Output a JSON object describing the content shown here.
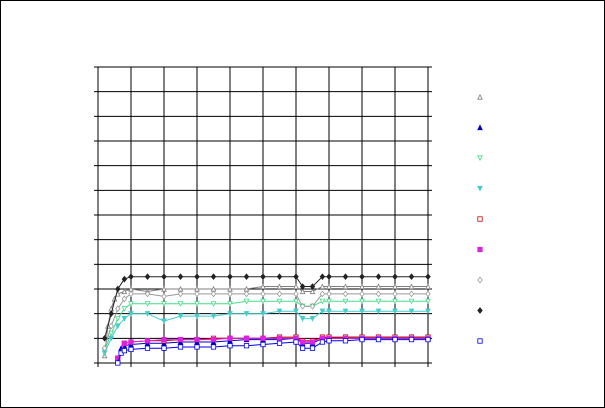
{
  "chart_data": {
    "type": "line",
    "title": "",
    "xlabel": "",
    "ylabel": "",
    "xlim": [
      0,
      10
    ],
    "ylim": [
      0,
      12
    ],
    "x_gridlines": 10,
    "y_gridlines": 12,
    "grid": true,
    "legend_placement": "right",
    "series": [
      {
        "marker": "triangle-up-open",
        "color": "#7f7f7f",
        "x": [
          0.2,
          0.3,
          0.4,
          0.5,
          0.6,
          0.8,
          1,
          1.5,
          2,
          2.5,
          3,
          3.5,
          4,
          4.5,
          5,
          5.5,
          6,
          6.2,
          6.5,
          6.8,
          7,
          7.5,
          8,
          8.5,
          9,
          9.5,
          10
        ],
        "y": [
          0.3,
          1.5,
          2.2,
          2.6,
          2.8,
          2.9,
          3.0,
          2.9,
          3.0,
          3.0,
          3.0,
          3.0,
          3.0,
          3.0,
          3.1,
          3.1,
          3.1,
          2.9,
          2.9,
          3.1,
          3.1,
          3.1,
          3.1,
          3.1,
          3.1,
          3.1,
          3.1
        ]
      },
      {
        "marker": "triangle-up",
        "color": "#0000cc",
        "x": [
          0.6,
          0.7,
          0.8,
          1,
          1.5,
          2,
          2.5,
          3,
          3.5,
          4,
          4.5,
          5,
          5.5,
          6,
          6.2,
          6.5,
          6.8,
          7,
          7.5,
          8,
          8.5,
          9,
          9.5,
          10
        ],
        "y": [
          0.1,
          0.6,
          0.7,
          0.75,
          0.8,
          0.8,
          0.85,
          0.85,
          0.85,
          0.9,
          0.95,
          0.95,
          0.95,
          1.0,
          0.8,
          0.8,
          1.0,
          1.0,
          1.05,
          1.05,
          1.05,
          1.05,
          1.05,
          1.05
        ]
      },
      {
        "marker": "triangle-down-open",
        "color": "#44dd88",
        "x": [
          0.2,
          0.4,
          0.6,
          0.8,
          1,
          1.5,
          2,
          2.5,
          3,
          3.5,
          4,
          4.5,
          5,
          5.5,
          6,
          6.2,
          6.5,
          6.8,
          7,
          7.5,
          8,
          8.5,
          9,
          9.5,
          10
        ],
        "y": [
          0.5,
          1.2,
          1.8,
          2.2,
          2.4,
          2.4,
          2.4,
          2.4,
          2.4,
          2.4,
          2.4,
          2.5,
          2.5,
          2.5,
          2.5,
          2.3,
          2.3,
          2.5,
          2.5,
          2.5,
          2.5,
          2.5,
          2.5,
          2.5,
          2.5
        ]
      },
      {
        "marker": "triangle-down",
        "color": "#44cccc",
        "x": [
          0.2,
          0.4,
          0.6,
          0.8,
          1,
          1.5,
          2,
          2.5,
          3,
          3.5,
          4,
          4.5,
          5,
          5.5,
          6,
          6.2,
          6.5,
          6.8,
          7,
          7.5,
          8,
          8.5,
          9,
          9.5,
          10
        ],
        "y": [
          0.4,
          1.0,
          1.5,
          1.8,
          2.0,
          2.0,
          1.7,
          1.9,
          1.9,
          1.9,
          2.0,
          2.0,
          2.0,
          2.1,
          2.1,
          1.8,
          1.8,
          2.1,
          2.1,
          2.1,
          2.1,
          2.1,
          2.1,
          2.1,
          2.1
        ]
      },
      {
        "marker": "square-open",
        "color": "#cc0000",
        "x": [
          0.6,
          0.8,
          1,
          1.5,
          2,
          2.5,
          3,
          3.5,
          4,
          4.5,
          5,
          5.5,
          6,
          6.2,
          6.5,
          6.8,
          7,
          7.5,
          8,
          8.5,
          9,
          9.5,
          10
        ],
        "y": [
          0.2,
          0.8,
          0.85,
          0.9,
          0.9,
          0.95,
          0.95,
          1.0,
          1.0,
          1.0,
          1.0,
          1.05,
          1.05,
          0.9,
          0.9,
          1.05,
          1.05,
          1.05,
          1.05,
          1.05,
          1.05,
          1.05,
          1.05
        ]
      },
      {
        "marker": "square",
        "color": "#dd22dd",
        "x": [
          0.6,
          0.8,
          1,
          1.5,
          2,
          2.5,
          3,
          3.5,
          4,
          4.5,
          5,
          5.5,
          6,
          6.2,
          6.5,
          6.8,
          7,
          7.5,
          8,
          8.5,
          9,
          9.5,
          10
        ],
        "y": [
          0.2,
          0.8,
          0.85,
          0.9,
          0.95,
          0.95,
          0.95,
          0.95,
          1.0,
          1.0,
          1.0,
          1.0,
          1.0,
          0.85,
          0.85,
          1.0,
          1.0,
          1.0,
          1.0,
          1.0,
          1.0,
          1.0,
          1.0
        ]
      },
      {
        "marker": "diamond-open",
        "color": "#999999",
        "x": [
          0.2,
          0.4,
          0.6,
          0.8,
          1,
          1.5,
          2,
          2.5,
          3,
          3.5,
          4,
          4.5,
          5,
          5.5,
          6,
          6.2,
          6.5,
          6.8,
          7,
          7.5,
          8,
          8.5,
          9,
          9.5,
          10
        ],
        "y": [
          0.6,
          1.5,
          2.2,
          2.6,
          2.8,
          2.8,
          2.7,
          2.8,
          2.8,
          2.8,
          2.8,
          2.8,
          2.8,
          2.8,
          2.8,
          2.3,
          2.3,
          2.8,
          2.8,
          2.8,
          2.8,
          2.8,
          2.8,
          2.8,
          2.8
        ]
      },
      {
        "marker": "diamond",
        "color": "#222222",
        "x": [
          0.2,
          0.4,
          0.6,
          0.8,
          1,
          1.5,
          2,
          2.5,
          3,
          3.5,
          4,
          4.5,
          5,
          5.5,
          6,
          6.2,
          6.5,
          6.8,
          7,
          7.5,
          8,
          8.5,
          9,
          9.5,
          10
        ],
        "y": [
          1.0,
          2.0,
          3.0,
          3.4,
          3.5,
          3.5,
          3.5,
          3.5,
          3.5,
          3.5,
          3.5,
          3.5,
          3.5,
          3.5,
          3.5,
          3.1,
          3.1,
          3.5,
          3.5,
          3.5,
          3.5,
          3.5,
          3.5,
          3.5,
          3.5
        ]
      },
      {
        "marker": "square-open",
        "color": "#0000ee",
        "x": [
          0.6,
          0.7,
          0.8,
          1,
          1.5,
          2,
          2.5,
          3,
          3.5,
          4,
          4.5,
          5,
          5.5,
          6,
          6.2,
          6.5,
          6.8,
          7,
          7.5,
          8,
          8.5,
          9,
          9.5,
          10
        ],
        "y": [
          0.0,
          0.4,
          0.5,
          0.55,
          0.6,
          0.6,
          0.65,
          0.65,
          0.65,
          0.7,
          0.7,
          0.75,
          0.8,
          0.85,
          0.6,
          0.6,
          0.85,
          0.9,
          0.9,
          0.95,
          0.95,
          0.95,
          0.95,
          0.95
        ]
      }
    ]
  }
}
